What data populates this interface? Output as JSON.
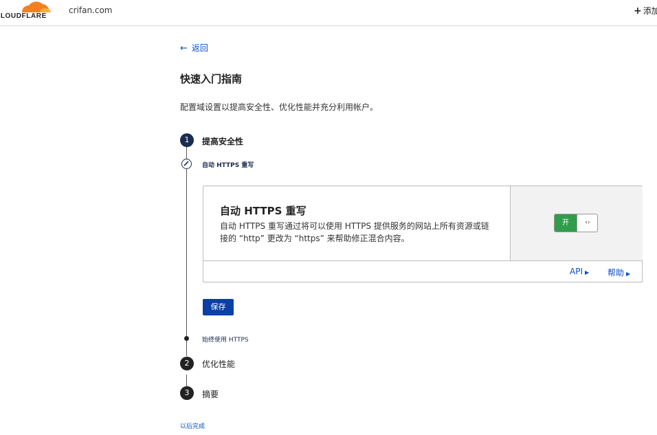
{
  "header": {
    "logo_text": "CLOUDFLARE",
    "domain": "crifan.com",
    "add_label": "添加"
  },
  "back_label": "返回",
  "page_title": "快速入门指南",
  "page_description": "配置域设置以提高安全性、优化性能并充分利用帐户。",
  "steps": [
    {
      "number": "1",
      "label": "提高安全性"
    },
    {
      "number": "2",
      "label": "优化性能"
    },
    {
      "number": "3",
      "label": "摘要"
    }
  ],
  "substeps": [
    {
      "label": "自动 HTTPS 重写",
      "state": "active"
    },
    {
      "label": "始终使用 HTTPS",
      "state": "pending"
    }
  ],
  "card": {
    "title": "自动 HTTPS 重写",
    "description": "自动 HTTPS 重写通过将可以使用 HTTPS 提供服务的网站上所有资源或链接的 “http” 更改为 “https” 来帮助修正混合内容。",
    "toggle_label": "开",
    "toggle_state": "on",
    "toggle_color": "#2f9d4c",
    "api_link": "API",
    "help_link": "帮助"
  },
  "save_label": "保存",
  "later_label": "以后完成",
  "colors": {
    "accent": "#0a3fa5",
    "link": "#0a4fc4",
    "logo_orange": "#f38020"
  }
}
